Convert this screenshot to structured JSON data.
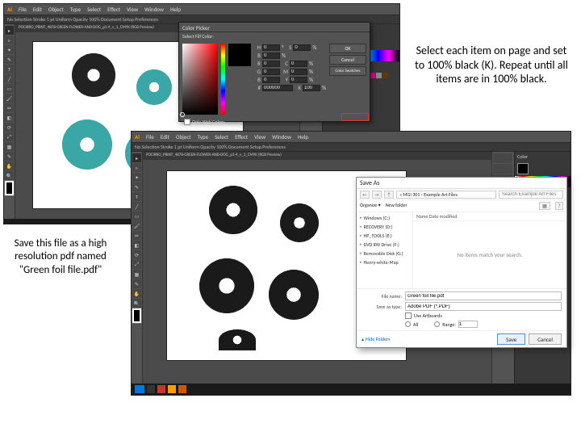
{
  "callouts": {
    "top_right": "Select each item on page and set to 100% black (K). Repeat until all items are in 100% black.",
    "left": "Save this file as a high resolution pdf named \"Green foil file.pdf\""
  },
  "illustrator": {
    "menu": [
      "File",
      "Edit",
      "Object",
      "Type",
      "Select",
      "Effect",
      "View",
      "Window",
      "Help"
    ],
    "doc_tab": "POCIRRO_PRINT_4878-GREEN-FLOWER-AND-DOG_p1-4_v_1_CMYK (RGB Preview)",
    "control_bar": "No Selection    Stroke    1 pt    Uniform    Opacity 100%    Document Setup    Preferences"
  },
  "color_picker": {
    "title": "Color Picker",
    "subtitle": "Select Fill Color:",
    "ok": "OK",
    "cancel": "Cancel",
    "swatches_btn": "Color Swatches",
    "hsb": {
      "H": "0",
      "S": "0",
      "B": "0"
    },
    "rgb": {
      "R": "0",
      "G": "0",
      "B": "0"
    },
    "cmyk": {
      "C": "0",
      "M": "0",
      "Y": "0",
      "K": "100"
    },
    "hex": "000000",
    "only_web": "Only Web Colors"
  },
  "save_dialog": {
    "title": "Save As",
    "path": "« MGI 301 › Example Art Files",
    "search_placeholder": "Search Example Art Files",
    "organize": "Organize ▾",
    "new_folder": "New folder",
    "sidebar": [
      "Windows (C:)",
      "RECOVERY (D:)",
      "HP_TOOLS (E:)",
      "DVD RW Drive (F:)",
      "Removable Disk (G:)",
      "Henry-white-Map"
    ],
    "list_header": "Name                                  Date modified",
    "empty_text": "No items match your search.",
    "file_name_label": "File name:",
    "file_name": "Green foil file.pdf",
    "save_type_label": "Save as type:",
    "save_type": "Adobe PDF (*.PDF)",
    "use_artboards": "Use Artboards",
    "all": "All",
    "range": "Range:",
    "range_val": "1",
    "hide_folders": "Hide Folders",
    "save": "Save",
    "cancel": "Cancel"
  }
}
